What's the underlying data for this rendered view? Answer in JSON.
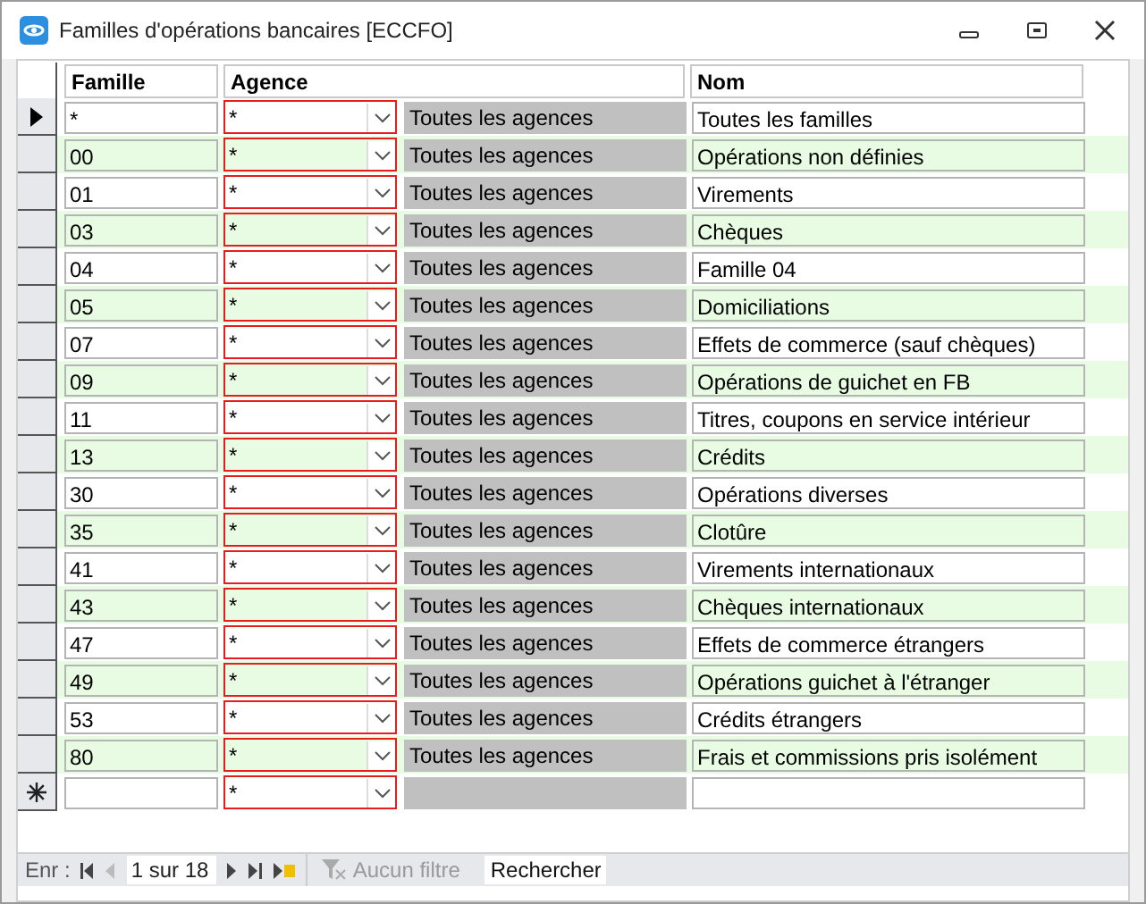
{
  "window": {
    "title": "Familles d'opérations bancaires [ECCFO]"
  },
  "columns": [
    "Famille",
    "Agence",
    "Nom"
  ],
  "rows": [
    {
      "famille": "*",
      "agence": "*",
      "agence_label": "Toutes les agences",
      "nom": "Toutes les familles",
      "selected": true
    },
    {
      "famille": "00",
      "agence": "*",
      "agence_label": "Toutes les agences",
      "nom": "Opérations non définies",
      "selected": false
    },
    {
      "famille": "01",
      "agence": "*",
      "agence_label": "Toutes les agences",
      "nom": "Virements",
      "selected": false
    },
    {
      "famille": "03",
      "agence": "*",
      "agence_label": "Toutes les agences",
      "nom": "Chèques",
      "selected": false
    },
    {
      "famille": "04",
      "agence": "*",
      "agence_label": "Toutes les agences",
      "nom": "Famille 04",
      "selected": false
    },
    {
      "famille": "05",
      "agence": "*",
      "agence_label": "Toutes les agences",
      "nom": "Domiciliations",
      "selected": false
    },
    {
      "famille": "07",
      "agence": "*",
      "agence_label": "Toutes les agences",
      "nom": "Effets de commerce (sauf chèques)",
      "selected": false
    },
    {
      "famille": "09",
      "agence": "*",
      "agence_label": "Toutes les agences",
      "nom": "Opérations de guichet en FB",
      "selected": false
    },
    {
      "famille": "11",
      "agence": "*",
      "agence_label": "Toutes les agences",
      "nom": "Titres, coupons en service intérieur",
      "selected": false
    },
    {
      "famille": "13",
      "agence": "*",
      "agence_label": "Toutes les agences",
      "nom": "Crédits",
      "selected": false
    },
    {
      "famille": "30",
      "agence": "*",
      "agence_label": "Toutes les agences",
      "nom": "Opérations diverses",
      "selected": false
    },
    {
      "famille": "35",
      "agence": "*",
      "agence_label": "Toutes les agences",
      "nom": "Clotûre",
      "selected": false
    },
    {
      "famille": "41",
      "agence": "*",
      "agence_label": "Toutes les agences",
      "nom": "Virements internationaux",
      "selected": false
    },
    {
      "famille": "43",
      "agence": "*",
      "agence_label": "Toutes les agences",
      "nom": "Chèques internationaux",
      "selected": false
    },
    {
      "famille": "47",
      "agence": "*",
      "agence_label": "Toutes les agences",
      "nom": "Effets de commerce étrangers",
      "selected": false
    },
    {
      "famille": "49",
      "agence": "*",
      "agence_label": "Toutes les agences",
      "nom": "Opérations guichet à l'étranger",
      "selected": false
    },
    {
      "famille": "53",
      "agence": "*",
      "agence_label": "Toutes les agences",
      "nom": "Crédits étrangers",
      "selected": false
    },
    {
      "famille": "80",
      "agence": "*",
      "agence_label": "Toutes les agences",
      "nom": "Frais et commissions pris isolément",
      "selected": false
    }
  ],
  "new_row": {
    "agence": "*"
  },
  "navigation": {
    "label": "Enr :",
    "position": "1 sur 18",
    "filter": "Aucun filtre",
    "search": "Rechercher"
  }
}
